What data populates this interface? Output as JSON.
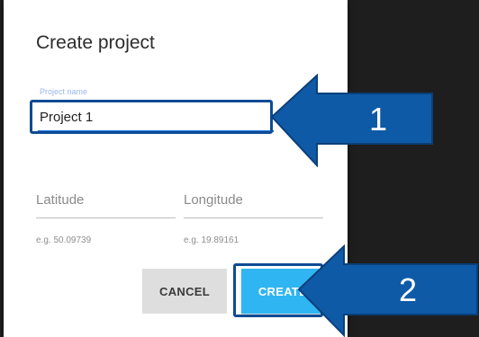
{
  "dialog": {
    "title": "Create project",
    "project_name": {
      "label": "Project name",
      "value": "Project 1"
    },
    "latitude": {
      "label": "Latitude",
      "hint": "e.g. 50.09739"
    },
    "longitude": {
      "label": "Longitude",
      "hint": "e.g. 19.89161"
    },
    "buttons": {
      "cancel": "CANCEL",
      "create": "CREATE"
    }
  },
  "callouts": {
    "step1": "1",
    "step2": "2"
  },
  "colors": {
    "accent": "#1a73e8",
    "create_button": "#2fb5f2",
    "callout_arrow": "#0e5aa7",
    "callout_border": "#0e4b94"
  }
}
